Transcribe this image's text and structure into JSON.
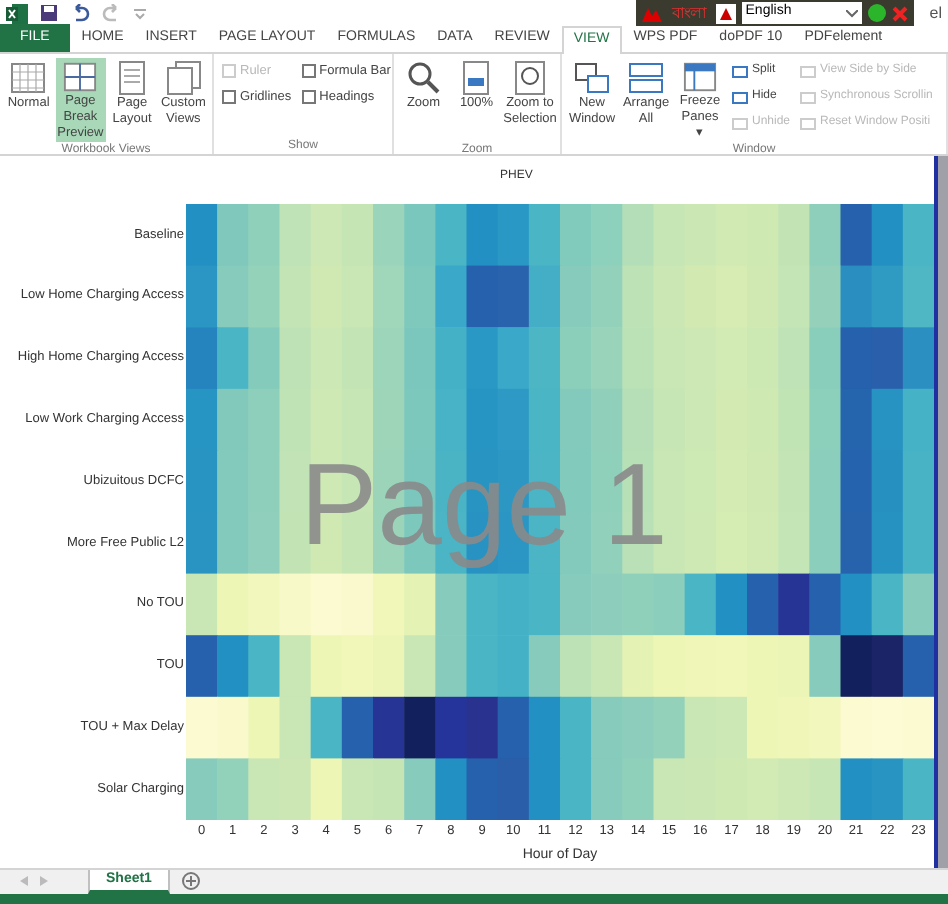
{
  "language_bar": {
    "script_label": "বাংলা",
    "language": "English",
    "account": "el"
  },
  "tabs": [
    {
      "label": "FILE",
      "kind": "file",
      "selected": false
    },
    {
      "label": "HOME",
      "kind": "tab",
      "selected": false
    },
    {
      "label": "INSERT",
      "kind": "tab",
      "selected": false
    },
    {
      "label": "PAGE LAYOUT",
      "kind": "tab",
      "selected": false
    },
    {
      "label": "FORMULAS",
      "kind": "tab",
      "selected": false
    },
    {
      "label": "DATA",
      "kind": "tab",
      "selected": false
    },
    {
      "label": "REVIEW",
      "kind": "tab",
      "selected": false
    },
    {
      "label": "VIEW",
      "kind": "tab",
      "selected": true
    },
    {
      "label": "WPS PDF",
      "kind": "tab",
      "selected": false
    },
    {
      "label": "doPDF 10",
      "kind": "tab",
      "selected": false
    },
    {
      "label": "PDFelement",
      "kind": "tab",
      "selected": false
    }
  ],
  "ribbon_groups": [
    {
      "title": "Workbook Views",
      "controls": [
        {
          "kind": "large",
          "label": "Normal",
          "selected": false
        },
        {
          "kind": "large",
          "label": "Page Break Preview",
          "selected": true
        },
        {
          "kind": "large",
          "label": "Page Layout",
          "selected": false
        },
        {
          "kind": "large",
          "label": "Custom Views",
          "selected": false
        }
      ]
    },
    {
      "title": "Show",
      "controls": [
        {
          "kind": "checkbox",
          "label": "Ruler",
          "checked": false,
          "disabled": true
        },
        {
          "kind": "checkbox",
          "label": "Gridlines",
          "checked": false,
          "disabled": false
        },
        {
          "kind": "checkbox",
          "label": "Formula Bar",
          "checked": false,
          "disabled": false
        },
        {
          "kind": "checkbox",
          "label": "Headings",
          "checked": false,
          "disabled": false
        }
      ]
    },
    {
      "title": "Zoom",
      "controls": [
        {
          "kind": "large",
          "label": "Zoom",
          "selected": false
        },
        {
          "kind": "large",
          "label": "100%",
          "selected": false
        },
        {
          "kind": "large",
          "label": "Zoom to Selection",
          "selected": false
        }
      ]
    },
    {
      "title": "Window",
      "controls": [
        {
          "kind": "large",
          "label": "New Window",
          "selected": false
        },
        {
          "kind": "large",
          "label": "Arrange All",
          "selected": false
        },
        {
          "kind": "large",
          "label": "Freeze Panes ▾",
          "selected": false
        },
        {
          "kind": "small",
          "label": "Split",
          "disabled": false
        },
        {
          "kind": "small",
          "label": "Hide",
          "disabled": false
        },
        {
          "kind": "small",
          "label": "Unhide",
          "disabled": true
        },
        {
          "kind": "small",
          "label": "View Side by Side",
          "disabled": true
        },
        {
          "kind": "small",
          "label": "Synchronous Scrollin",
          "disabled": true
        },
        {
          "kind": "small",
          "label": "Reset Window Positi",
          "disabled": true
        }
      ]
    }
  ],
  "heatmap": {
    "title": "PHEV",
    "page_label": "Page 1",
    "xlabel": "Hour of Day",
    "columns": [
      "0",
      "1",
      "2",
      "3",
      "4",
      "5",
      "6",
      "7",
      "8",
      "9",
      "10",
      "11",
      "12",
      "13",
      "14",
      "15",
      "16",
      "17",
      "18",
      "19",
      "20",
      "21",
      "22",
      "23"
    ],
    "rows": [
      {
        "label": "Baseline",
        "cells": [
          {
            "color": "#2290c2"
          },
          {
            "color": "#7fc8bb"
          },
          {
            "color": "#8fd0bb"
          },
          {
            "color": "#bfe3b6"
          },
          {
            "color": "#cde8b4"
          },
          {
            "color": "#c5e5b5"
          },
          {
            "color": "#9ad4ba"
          },
          {
            "color": "#7ac7bd"
          },
          {
            "color": "#49b5c5"
          },
          {
            "color": "#2290c2"
          },
          {
            "color": "#2a98c4"
          },
          {
            "color": "#49b5c5"
          },
          {
            "color": "#80cbbc"
          },
          {
            "color": "#8dd0bb"
          },
          {
            "color": "#b4deb7"
          },
          {
            "color": "#c6e6b5"
          },
          {
            "color": "#cbe8b4"
          },
          {
            "color": "#d1eab3"
          },
          {
            "color": "#cfe9b3"
          },
          {
            "color": "#c2e4b5"
          },
          {
            "color": "#8dcfbb"
          },
          {
            "color": "#2561ad"
          },
          {
            "color": "#2290c2"
          },
          {
            "color": "#49b5c5"
          }
        ]
      },
      {
        "label": "Low Home Charging Access",
        "cells": [
          {
            "color": "#2b96c3"
          },
          {
            "color": "#86cbbb"
          },
          {
            "color": "#94d2ba"
          },
          {
            "color": "#c3e4b5"
          },
          {
            "color": "#d0e9b3"
          },
          {
            "color": "#c8e7b4"
          },
          {
            "color": "#a0d6b9"
          },
          {
            "color": "#7fc8bc"
          },
          {
            "color": "#3aa8c8"
          },
          {
            "color": "#2561ad"
          },
          {
            "color": "#2a63ad"
          },
          {
            "color": "#43aec6"
          },
          {
            "color": "#86cbbb"
          },
          {
            "color": "#93d1ba"
          },
          {
            "color": "#bde2b6"
          },
          {
            "color": "#cbe7b4"
          },
          {
            "color": "#d2eab2"
          },
          {
            "color": "#d6ecb2"
          },
          {
            "color": "#d0e9b3"
          },
          {
            "color": "#c4e5b5"
          },
          {
            "color": "#95d1ba"
          },
          {
            "color": "#2a8ec0"
          },
          {
            "color": "#2f9bc3"
          },
          {
            "color": "#4fb7c4"
          }
        ]
      },
      {
        "label": "High Home Charging Access",
        "cells": [
          {
            "color": "#2583be"
          },
          {
            "color": "#49b5c5"
          },
          {
            "color": "#85cbbb"
          },
          {
            "color": "#bee2b6"
          },
          {
            "color": "#cce8b4"
          },
          {
            "color": "#c3e4b5"
          },
          {
            "color": "#9cd5b9"
          },
          {
            "color": "#7cc7bd"
          },
          {
            "color": "#45b1c6"
          },
          {
            "color": "#2a98c4"
          },
          {
            "color": "#3aa8c8"
          },
          {
            "color": "#4db6c4"
          },
          {
            "color": "#8bceba"
          },
          {
            "color": "#98d3ba"
          },
          {
            "color": "#bbe1b6"
          },
          {
            "color": "#c8e7b4"
          },
          {
            "color": "#cde8b4"
          },
          {
            "color": "#d2eab3"
          },
          {
            "color": "#cde9b3"
          },
          {
            "color": "#bfe3b6"
          },
          {
            "color": "#89cdbb"
          },
          {
            "color": "#2561ad"
          },
          {
            "color": "#2a5fab"
          },
          {
            "color": "#2c8fc1"
          }
        ]
      },
      {
        "label": "Low Work Charging Access",
        "cells": [
          {
            "color": "#2795c3"
          },
          {
            "color": "#82c9bc"
          },
          {
            "color": "#8dcfbb"
          },
          {
            "color": "#c0e3b6"
          },
          {
            "color": "#cee9b4"
          },
          {
            "color": "#c7e6b5"
          },
          {
            "color": "#9ed5b9"
          },
          {
            "color": "#7dc8bd"
          },
          {
            "color": "#48b3c6"
          },
          {
            "color": "#2795c3"
          },
          {
            "color": "#2d99c4"
          },
          {
            "color": "#4ab5c5"
          },
          {
            "color": "#83cabc"
          },
          {
            "color": "#90d0bb"
          },
          {
            "color": "#b6dfb7"
          },
          {
            "color": "#c7e6b5"
          },
          {
            "color": "#cce8b4"
          },
          {
            "color": "#d3ebb3"
          },
          {
            "color": "#cfe9b3"
          },
          {
            "color": "#c1e4b5"
          },
          {
            "color": "#8ccfbb"
          },
          {
            "color": "#2565ae"
          },
          {
            "color": "#2793c2"
          },
          {
            "color": "#46b2c5"
          }
        ]
      },
      {
        "label": "Ubizuitous DCFC",
        "cells": [
          {
            "color": "#2894c2"
          },
          {
            "color": "#84cabc"
          },
          {
            "color": "#8ecfbb"
          },
          {
            "color": "#c1e3b6"
          },
          {
            "color": "#cfe9b4"
          },
          {
            "color": "#c6e6b5"
          },
          {
            "color": "#9bd4b9"
          },
          {
            "color": "#7bc7bd"
          },
          {
            "color": "#4ab4c5"
          },
          {
            "color": "#2894c2"
          },
          {
            "color": "#2c97c3"
          },
          {
            "color": "#4bb5c5"
          },
          {
            "color": "#82cabc"
          },
          {
            "color": "#8fd0bb"
          },
          {
            "color": "#b8e0b7"
          },
          {
            "color": "#c8e7b4"
          },
          {
            "color": "#cde9b4"
          },
          {
            "color": "#d4ebb3"
          },
          {
            "color": "#d0e9b3"
          },
          {
            "color": "#c3e4b5"
          },
          {
            "color": "#8acebb"
          },
          {
            "color": "#2663ae"
          },
          {
            "color": "#2691c1"
          },
          {
            "color": "#47b3c5"
          }
        ]
      },
      {
        "label": "More Free Public L2",
        "cells": [
          {
            "color": "#2993c2"
          },
          {
            "color": "#83cabc"
          },
          {
            "color": "#8fcfbb"
          },
          {
            "color": "#c2e4b5"
          },
          {
            "color": "#d0e9b3"
          },
          {
            "color": "#c5e5b5"
          },
          {
            "color": "#9cd4b9"
          },
          {
            "color": "#7cc8bd"
          },
          {
            "color": "#4bb4c5"
          },
          {
            "color": "#2892c2"
          },
          {
            "color": "#2b96c3"
          },
          {
            "color": "#4cb5c5"
          },
          {
            "color": "#84cabc"
          },
          {
            "color": "#91d0bb"
          },
          {
            "color": "#b9e0b6"
          },
          {
            "color": "#c9e7b4"
          },
          {
            "color": "#cee9b4"
          },
          {
            "color": "#d5ecb3"
          },
          {
            "color": "#d1eab3"
          },
          {
            "color": "#c4e5b5"
          },
          {
            "color": "#8bcebb"
          },
          {
            "color": "#2762ad"
          },
          {
            "color": "#2692c2"
          },
          {
            "color": "#48b3c5"
          }
        ]
      },
      {
        "label": "No TOU",
        "cells": [
          {
            "color": "#c9e6b5"
          },
          {
            "color": "#eef6b6"
          },
          {
            "color": "#f2f7bd"
          },
          {
            "color": "#f8f9c8"
          },
          {
            "color": "#fbfad0"
          },
          {
            "color": "#faf9cd"
          },
          {
            "color": "#f0f7b9"
          },
          {
            "color": "#e4f2b4"
          },
          {
            "color": "#86cbbb"
          },
          {
            "color": "#49b5c5"
          },
          {
            "color": "#45b1c6"
          },
          {
            "color": "#4ab5c5"
          },
          {
            "color": "#86cbbb"
          },
          {
            "color": "#8ccebb"
          },
          {
            "color": "#8fd0bb"
          },
          {
            "color": "#8acebb"
          },
          {
            "color": "#49b5c5"
          },
          {
            "color": "#2290c2"
          },
          {
            "color": "#2561ad"
          },
          {
            "color": "#253495"
          },
          {
            "color": "#2561ad"
          },
          {
            "color": "#2290c2"
          },
          {
            "color": "#49b5c5"
          },
          {
            "color": "#86cbbb"
          }
        ]
      },
      {
        "label": "TOU",
        "cells": [
          {
            "color": "#2561ad"
          },
          {
            "color": "#2290c2"
          },
          {
            "color": "#49b5c5"
          },
          {
            "color": "#c9e6b5"
          },
          {
            "color": "#eef6b6"
          },
          {
            "color": "#f0f7b9"
          },
          {
            "color": "#ecf5b5"
          },
          {
            "color": "#c9e6b5"
          },
          {
            "color": "#86cbbb"
          },
          {
            "color": "#49b5c5"
          },
          {
            "color": "#45b1c6"
          },
          {
            "color": "#86cbbb"
          },
          {
            "color": "#bde2b6"
          },
          {
            "color": "#c9e6b5"
          },
          {
            "color": "#e4f2b4"
          },
          {
            "color": "#eef6b6"
          },
          {
            "color": "#eff6b7"
          },
          {
            "color": "#f0f7b9"
          },
          {
            "color": "#eef6b6"
          },
          {
            "color": "#ebf5b5"
          },
          {
            "color": "#86cbbb"
          },
          {
            "color": "#13205e"
          },
          {
            "color": "#1a2466"
          },
          {
            "color": "#2561ad"
          }
        ]
      },
      {
        "label": "TOU + Max Delay",
        "cells": [
          {
            "color": "#fbfad0"
          },
          {
            "color": "#f9f9cb"
          },
          {
            "color": "#eef6b6"
          },
          {
            "color": "#c9e6b5"
          },
          {
            "color": "#49b5c5"
          },
          {
            "color": "#2561ad"
          },
          {
            "color": "#253495"
          },
          {
            "color": "#13205e"
          },
          {
            "color": "#25349a"
          },
          {
            "color": "#2a3290"
          },
          {
            "color": "#2561ad"
          },
          {
            "color": "#2290c2"
          },
          {
            "color": "#49b5c5"
          },
          {
            "color": "#86cbbb"
          },
          {
            "color": "#8ccebb"
          },
          {
            "color": "#93d1ba"
          },
          {
            "color": "#c9e6b5"
          },
          {
            "color": "#cce8b4"
          },
          {
            "color": "#eef6b6"
          },
          {
            "color": "#eff6b8"
          },
          {
            "color": "#f2f7bd"
          },
          {
            "color": "#fbfad0"
          },
          {
            "color": "#fcfbd4"
          },
          {
            "color": "#fbfad0"
          }
        ]
      },
      {
        "label": "Solar Charging",
        "cells": [
          {
            "color": "#86cbbb"
          },
          {
            "color": "#92d1ba"
          },
          {
            "color": "#c9e6b5"
          },
          {
            "color": "#cce7b4"
          },
          {
            "color": "#eef6b6"
          },
          {
            "color": "#c9e6b5"
          },
          {
            "color": "#c6e5b5"
          },
          {
            "color": "#86cbbb"
          },
          {
            "color": "#2290c2"
          },
          {
            "color": "#2561ad"
          },
          {
            "color": "#2a5ea9"
          },
          {
            "color": "#2290c2"
          },
          {
            "color": "#49b5c5"
          },
          {
            "color": "#86cbbb"
          },
          {
            "color": "#8fd0bb"
          },
          {
            "color": "#c9e6b5"
          },
          {
            "color": "#cbe8b4"
          },
          {
            "color": "#cfe9b3"
          },
          {
            "color": "#d2eab3"
          },
          {
            "color": "#cde8b4"
          },
          {
            "color": "#c7e6b5"
          },
          {
            "color": "#2290c2"
          },
          {
            "color": "#2894c2"
          },
          {
            "color": "#49b5c5"
          }
        ]
      }
    ]
  },
  "sheet_tabs": [
    {
      "label": "Sheet1",
      "selected": true
    }
  ]
}
